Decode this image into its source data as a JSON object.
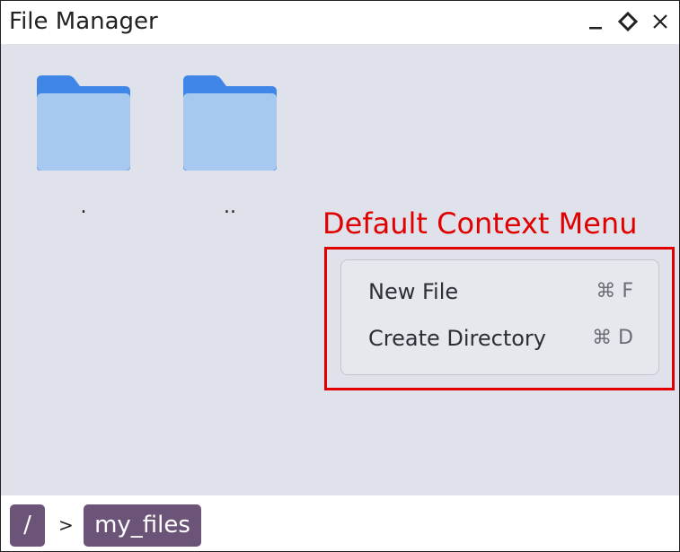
{
  "window": {
    "title": "File Manager",
    "controls": [
      "minimize-icon",
      "maximize-icon",
      "close-icon"
    ]
  },
  "files": [
    {
      "name": ".",
      "icon": "folder-icon"
    },
    {
      "name": "..",
      "icon": "folder-icon"
    }
  ],
  "annotation": {
    "label": "Default Context Menu",
    "color": "#e00000"
  },
  "context_menu": {
    "items": [
      {
        "label": "New File",
        "shortcut": "⌘ F"
      },
      {
        "label": "Create Directory",
        "shortcut": "⌘ D"
      }
    ]
  },
  "breadcrumb": {
    "root": "/",
    "separator": ">",
    "current": "my_files",
    "color": "#6b5478"
  },
  "colors": {
    "content_bg": "#dfe2ea",
    "folder_back": "#3f86e6",
    "folder_front": "#a7c8ef"
  }
}
